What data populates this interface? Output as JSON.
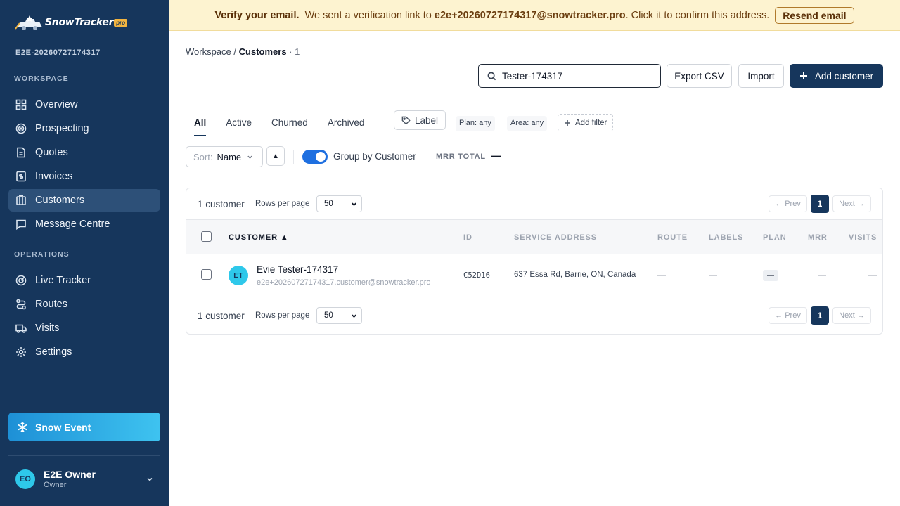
{
  "brand": {
    "name": "SnowTracker",
    "badge": "pro"
  },
  "workspace_id": "E2E-20260727174317",
  "sidebar": {
    "sections": [
      {
        "label": "WORKSPACE",
        "items": [
          {
            "label": "Overview",
            "icon": "grid-icon"
          },
          {
            "label": "Prospecting",
            "icon": "target-icon"
          },
          {
            "label": "Quotes",
            "icon": "document-icon"
          },
          {
            "label": "Invoices",
            "icon": "dollar-icon"
          },
          {
            "label": "Customers",
            "icon": "building-icon",
            "active": true
          },
          {
            "label": "Message Centre",
            "icon": "chat-icon"
          }
        ]
      },
      {
        "label": "OPERATIONS",
        "items": [
          {
            "label": "Live Tracker",
            "icon": "radar-icon"
          },
          {
            "label": "Routes",
            "icon": "route-icon"
          },
          {
            "label": "Visits",
            "icon": "truck-icon"
          },
          {
            "label": "Settings",
            "icon": "gear-icon"
          }
        ]
      }
    ],
    "snow_event": "Snow Event",
    "user": {
      "initials": "EO",
      "name": "E2E Owner",
      "role": "Owner"
    }
  },
  "banner": {
    "title": "Verify your email.",
    "pre": "We sent a verification link to",
    "email": "e2e+20260727174317@snowtracker.pro",
    "post": ". Click it to confirm this address.",
    "button": "Resend email"
  },
  "breadcrumb": {
    "root": "Workspace",
    "sep": "/",
    "current": "Customers",
    "count": "· 1"
  },
  "toolbar": {
    "search_value": "Tester-174317",
    "export": "Export CSV",
    "import": "Import",
    "add": "Add customer"
  },
  "tabs": [
    {
      "label": "All",
      "active": true
    },
    {
      "label": "Active"
    },
    {
      "label": "Churned"
    },
    {
      "label": "Archived"
    }
  ],
  "filters": {
    "label": "Label",
    "plan": "Plan: any",
    "area": "Area: any",
    "add": "Add filter"
  },
  "sort": {
    "label": "Sort:",
    "value": "Name",
    "dir": "▲"
  },
  "group": {
    "label": "Group by Customer",
    "on": true
  },
  "mrr": {
    "label": "MRR TOTAL",
    "value": "—"
  },
  "table": {
    "count": "1 customer",
    "rows_per_page_label": "Rows per page",
    "rows_per_page": "50",
    "prev": "← Prev",
    "next": "Next →",
    "page": "1",
    "columns": [
      "CUSTOMER ▲",
      "ID",
      "SERVICE ADDRESS",
      "ROUTE",
      "LABELS",
      "PLAN",
      "MRR",
      "VISITS"
    ],
    "rows": [
      {
        "initials": "ET",
        "name": "Evie Tester-174317",
        "email": "e2e+20260727174317.customer@snowtracker.pro",
        "id": "C52D16",
        "address": "637 Essa Rd, Barrie, ON, Canada",
        "route": "—",
        "labels": "—",
        "plan": "—",
        "mrr": "—",
        "visits": "—"
      }
    ]
  },
  "colors": {
    "navy": "#16365c",
    "accent": "#2ec8ea",
    "banner_bg": "#fdf3d0",
    "toggle": "#1e6fe0"
  }
}
